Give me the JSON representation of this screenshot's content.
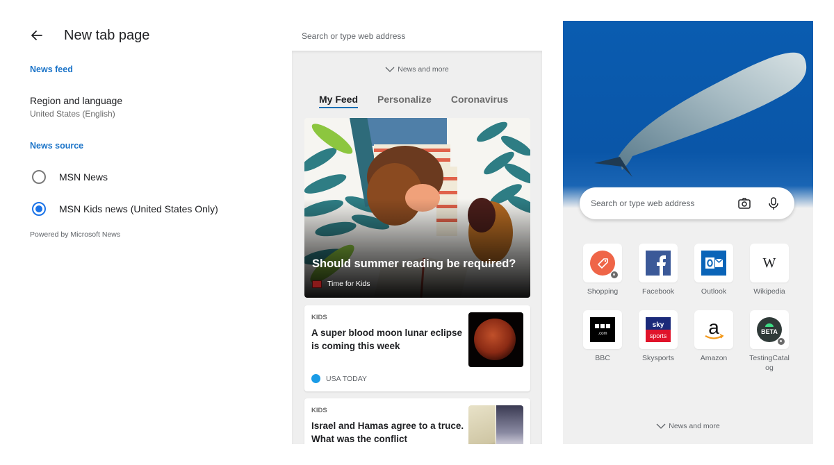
{
  "settings": {
    "title": "New tab page",
    "news_feed_header": "News feed",
    "region_title": "Region and language",
    "region_value": "United States (English)",
    "news_source_header": "News source",
    "sources": [
      {
        "label": "MSN News",
        "selected": false
      },
      {
        "label": "MSN Kids news (United States Only)",
        "selected": true
      }
    ],
    "powered_by": "Powered by Microsoft News",
    "accent_color": "#1a73e8"
  },
  "news": {
    "address_placeholder": "Search or type web address",
    "news_and_more": "News and more",
    "tabs": [
      {
        "label": "My Feed",
        "active": true
      },
      {
        "label": "Personalize",
        "active": false
      },
      {
        "label": "Coronavirus",
        "active": false
      }
    ],
    "hero": {
      "headline": "Should summer reading be required?",
      "source": "Time for Kids"
    },
    "cards": [
      {
        "category": "KIDS",
        "title": "A super blood moon lunar eclipse is coming this week",
        "source": "USA TODAY"
      },
      {
        "category": "KIDS",
        "title": "Israel and Hamas agree to a truce. What was the conflict",
        "source": ""
      }
    ]
  },
  "ntp": {
    "search_placeholder": "Search or type web address",
    "camera_icon": "camera-icon",
    "mic_icon": "microphone-icon",
    "tiles": [
      {
        "label": "Shopping"
      },
      {
        "label": "Facebook"
      },
      {
        "label": "Outlook"
      },
      {
        "label": "Wikipedia"
      },
      {
        "label": "BBC"
      },
      {
        "label": "Skysports"
      },
      {
        "label": "Amazon"
      },
      {
        "label": "TestingCatal og"
      }
    ],
    "news_and_more": "News and more"
  }
}
